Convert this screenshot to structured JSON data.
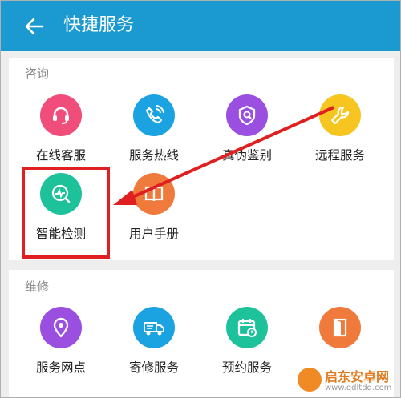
{
  "header": {
    "title": "快捷服务",
    "back_icon": "back-arrow-icon",
    "color": "#1a9ad0"
  },
  "consult": {
    "title": "咨询",
    "items": [
      {
        "label": "在线客服",
        "icon": "headset-icon",
        "color": "#f04d7a"
      },
      {
        "label": "服务热线",
        "icon": "phone-icon",
        "color": "#1aa3e0"
      },
      {
        "label": "真伪鉴别",
        "icon": "shield-icon",
        "color": "#9b4fe0"
      },
      {
        "label": "远程服务",
        "icon": "wrench-icon",
        "color": "#f7c520"
      },
      {
        "label": "智能检测",
        "icon": "detect-icon",
        "color": "#1ec29a"
      },
      {
        "label": "用户手册",
        "icon": "book-icon",
        "color": "#f07a3c"
      }
    ]
  },
  "repair": {
    "title": "维修",
    "items": [
      {
        "label": "服务网点",
        "icon": "location-pin-icon",
        "color": "#9b4fe0"
      },
      {
        "label": "寄修服务",
        "icon": "truck-icon",
        "color": "#1aa3e0"
      },
      {
        "label": "预约服务",
        "icon": "calendar-icon",
        "color": "#1ec29a"
      },
      {
        "label": "",
        "icon": "door-icon",
        "color": "#f07a3c"
      }
    ]
  },
  "watermark": {
    "name": "启东安卓网",
    "url": "www.qdltdq.com"
  }
}
